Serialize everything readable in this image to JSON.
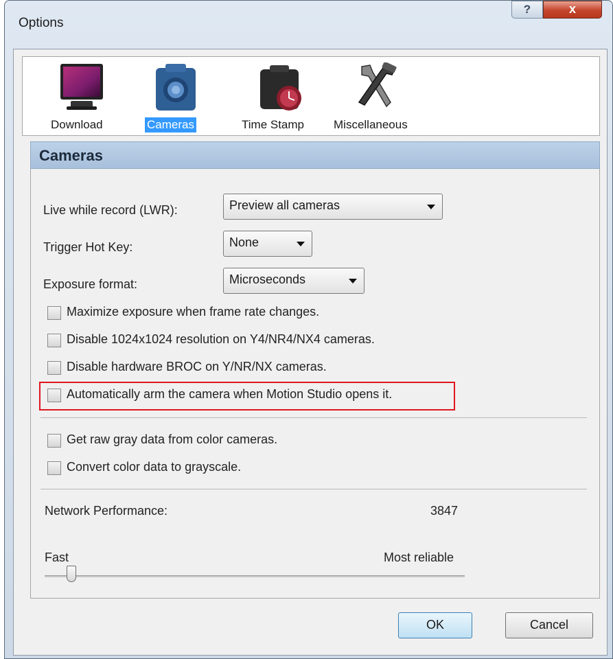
{
  "window": {
    "title": "Options",
    "help_label": "?",
    "close_label": "x"
  },
  "toolbar": {
    "items": [
      {
        "label": "Download",
        "icon": "monitor-icon",
        "selected": false
      },
      {
        "label": "Cameras",
        "icon": "camera-icon",
        "selected": true
      },
      {
        "label": "Time Stamp",
        "icon": "clock-camera-icon",
        "selected": false
      },
      {
        "label": "Miscellaneous",
        "icon": "tools-icon",
        "selected": false
      }
    ]
  },
  "section": {
    "title": "Cameras"
  },
  "fields": {
    "lwr_label": "Live while record (LWR):",
    "lwr_value": "Preview all cameras",
    "hotkey_label": "Trigger Hot Key:",
    "hotkey_value": "None",
    "exposure_label": "Exposure format:",
    "exposure_value": "Microseconds"
  },
  "checkboxes": [
    {
      "label": "Maximize exposure when frame rate changes.",
      "checked": false
    },
    {
      "label": "Disable 1024x1024 resolution on Y4/NR4/NX4 cameras.",
      "checked": false
    },
    {
      "label": "Disable hardware BROC on Y/NR/NX cameras.",
      "checked": false
    },
    {
      "label": "Automatically arm the camera when Motion Studio opens it.",
      "checked": false,
      "highlighted": true
    },
    {
      "label": "Get raw gray data from color cameras.",
      "checked": false
    },
    {
      "label": "Convert color data to grayscale.",
      "checked": false
    }
  ],
  "network": {
    "label": "Network Performance:",
    "value": "3847",
    "min_label": "Fast",
    "max_label": "Most reliable",
    "slider_fraction": 0.07
  },
  "buttons": {
    "ok": "OK",
    "cancel": "Cancel"
  },
  "colors": {
    "selection": "#3399ff",
    "highlight_box": "#e0141e",
    "section_header": "#b4cae3"
  }
}
